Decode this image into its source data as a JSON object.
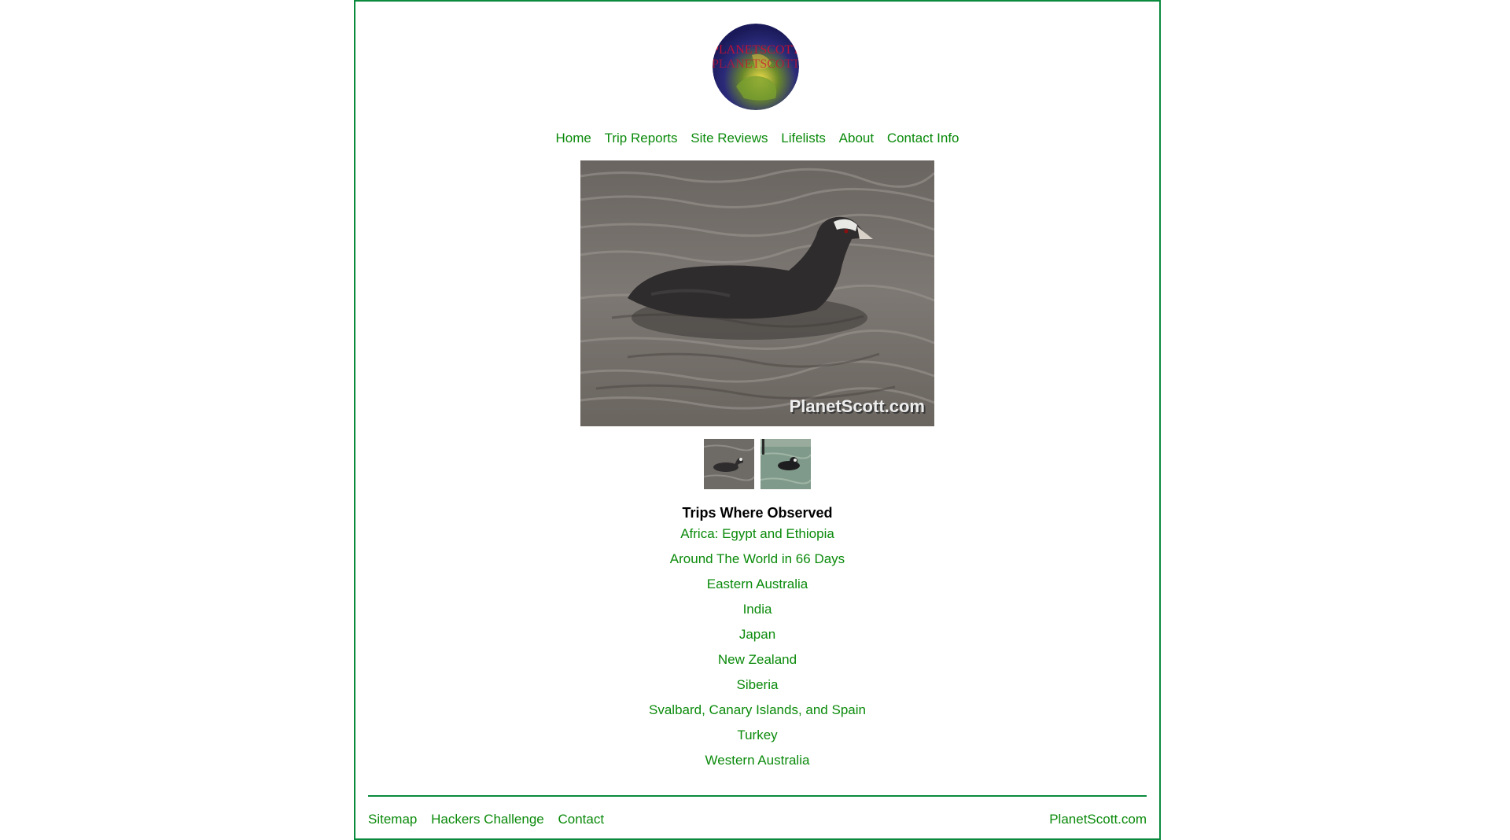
{
  "logo": {
    "text": "PLANETSCOTT",
    "icon": "globe-logo-icon"
  },
  "nav": {
    "items": [
      {
        "label": "Home"
      },
      {
        "label": "Trip Reports"
      },
      {
        "label": "Site Reviews"
      },
      {
        "label": "Lifelists"
      },
      {
        "label": "About"
      },
      {
        "label": "Contact Info"
      }
    ]
  },
  "photo": {
    "watermark": "PlanetScott.com"
  },
  "trips": {
    "title": "Trips Where Observed",
    "items": [
      {
        "label": "Africa: Egypt and Ethiopia"
      },
      {
        "label": "Around The World in 66 Days"
      },
      {
        "label": "Eastern Australia"
      },
      {
        "label": "India"
      },
      {
        "label": "Japan"
      },
      {
        "label": "New Zealand"
      },
      {
        "label": "Siberia"
      },
      {
        "label": "Svalbard, Canary Islands, and Spain"
      },
      {
        "label": "Turkey"
      },
      {
        "label": "Western Australia"
      }
    ]
  },
  "footer": {
    "links": [
      {
        "label": "Sitemap"
      },
      {
        "label": "Hackers Challenge"
      },
      {
        "label": "Contact"
      }
    ],
    "site": "PlanetScott.com"
  },
  "colors": {
    "link": "#0a8a0a",
    "border": "#0a8a3c"
  }
}
